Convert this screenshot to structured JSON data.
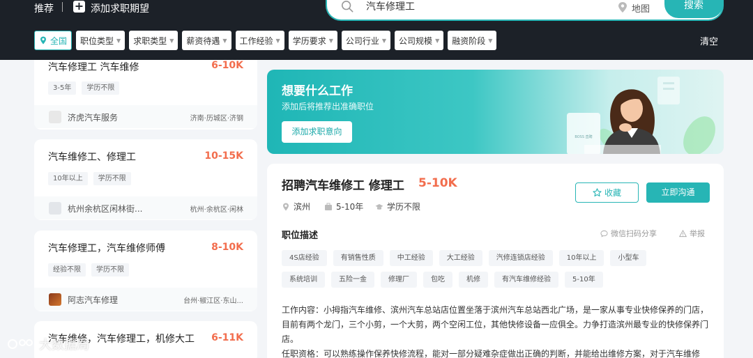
{
  "header": {
    "recommend": "推荐",
    "add_expectation": "添加求职期望",
    "search_value": "汽车修理工",
    "map_label": "地图",
    "search_button": "搜索",
    "clear": "清空"
  },
  "filters": [
    "全国",
    "职位类型",
    "求职类型",
    "薪资待遇",
    "工作经验",
    "学历要求",
    "公司行业",
    "公司规模",
    "融资阶段"
  ],
  "jobs": [
    {
      "title": "汽车修理工 汽车维修",
      "salary": "6-10K",
      "tags": [
        "3-5年",
        "学历不限"
      ],
      "company": "济虎汽车服务",
      "location": "济南·历城区·济钢"
    },
    {
      "title": "汽车维修工、修理工",
      "salary": "10-15K",
      "tags": [
        "10年以上",
        "学历不限"
      ],
      "company": "杭州余杭区闲林街...",
      "location": "杭州·余杭区·闲林"
    },
    {
      "title": "汽车修理工，汽车维修师傅",
      "salary": "8-10K",
      "tags": [
        "经验不限",
        "学历不限"
      ],
      "company": "阿志汽车修理",
      "location": "台州·椒江区·东山..."
    },
    {
      "title": "汽车维修，汽车修理工，机修大工",
      "salary": "6-11K",
      "tags": [
        "",
        ""
      ],
      "company": "",
      "location": ""
    }
  ],
  "banner": {
    "title": "想要什么工作",
    "subtitle": "添加后将推荐出准确职位",
    "button": "添加求职意向",
    "sign": "BOSS 直聘"
  },
  "detail": {
    "title": "招聘汽车维修工 修理工",
    "salary": "5-10K",
    "city": "滨州",
    "experience": "5-10年",
    "education": "学历不限",
    "favorite": "收藏",
    "chat": "立即沟通",
    "section": "职位描述",
    "share": "微信扫码分享",
    "report": "举报",
    "tags_row1": [
      "4S店经验",
      "有销售性质",
      "中工经验",
      "大工经验",
      "汽修连锁店经验",
      "10年以上",
      "小型车"
    ],
    "tags_row2": [
      "系统培训",
      "五险一金",
      "修理厂",
      "包吃",
      "机修",
      "有汽车维修经验",
      "5-10年"
    ],
    "desc_1": "工作内容：小拇指汽车维修、滨州汽车总站店位置坐落于滨州汽车总站西北广场，是一家从事专业快修保养的门店，目前有两个龙门，三个小剪，一个大剪，两个空闲工位，其他快修设备一应俱全。力争打造滨州最专业的快修保养门店。",
    "desc_2": "任职资格：可以熟练操作保养快修流程，能对一部分疑难杂症做出正确的判断，并能给出维修方案，对于汽车维修"
  },
  "watermark": "大数据局",
  "colors": {
    "accent": "#27b5b5",
    "salary": "#f26d4d",
    "header_bg": "#1c2128"
  }
}
